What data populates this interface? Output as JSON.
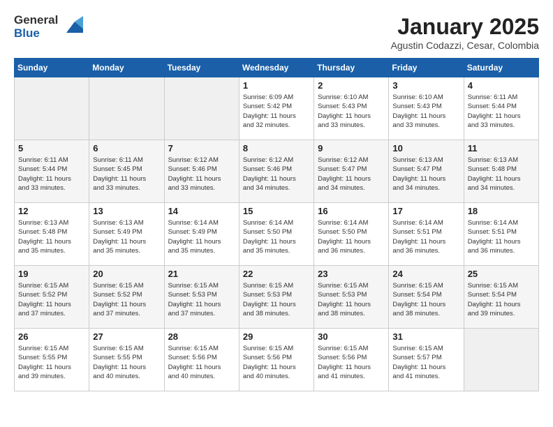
{
  "header": {
    "logo_general": "General",
    "logo_blue": "Blue",
    "month_title": "January 2025",
    "subtitle": "Agustin Codazzi, Cesar, Colombia"
  },
  "weekdays": [
    "Sunday",
    "Monday",
    "Tuesday",
    "Wednesday",
    "Thursday",
    "Friday",
    "Saturday"
  ],
  "weeks": [
    [
      {
        "day": "",
        "info": ""
      },
      {
        "day": "",
        "info": ""
      },
      {
        "day": "",
        "info": ""
      },
      {
        "day": "1",
        "info": "Sunrise: 6:09 AM\nSunset: 5:42 PM\nDaylight: 11 hours\nand 32 minutes."
      },
      {
        "day": "2",
        "info": "Sunrise: 6:10 AM\nSunset: 5:43 PM\nDaylight: 11 hours\nand 33 minutes."
      },
      {
        "day": "3",
        "info": "Sunrise: 6:10 AM\nSunset: 5:43 PM\nDaylight: 11 hours\nand 33 minutes."
      },
      {
        "day": "4",
        "info": "Sunrise: 6:11 AM\nSunset: 5:44 PM\nDaylight: 11 hours\nand 33 minutes."
      }
    ],
    [
      {
        "day": "5",
        "info": "Sunrise: 6:11 AM\nSunset: 5:44 PM\nDaylight: 11 hours\nand 33 minutes."
      },
      {
        "day": "6",
        "info": "Sunrise: 6:11 AM\nSunset: 5:45 PM\nDaylight: 11 hours\nand 33 minutes."
      },
      {
        "day": "7",
        "info": "Sunrise: 6:12 AM\nSunset: 5:46 PM\nDaylight: 11 hours\nand 33 minutes."
      },
      {
        "day": "8",
        "info": "Sunrise: 6:12 AM\nSunset: 5:46 PM\nDaylight: 11 hours\nand 34 minutes."
      },
      {
        "day": "9",
        "info": "Sunrise: 6:12 AM\nSunset: 5:47 PM\nDaylight: 11 hours\nand 34 minutes."
      },
      {
        "day": "10",
        "info": "Sunrise: 6:13 AM\nSunset: 5:47 PM\nDaylight: 11 hours\nand 34 minutes."
      },
      {
        "day": "11",
        "info": "Sunrise: 6:13 AM\nSunset: 5:48 PM\nDaylight: 11 hours\nand 34 minutes."
      }
    ],
    [
      {
        "day": "12",
        "info": "Sunrise: 6:13 AM\nSunset: 5:48 PM\nDaylight: 11 hours\nand 35 minutes."
      },
      {
        "day": "13",
        "info": "Sunrise: 6:13 AM\nSunset: 5:49 PM\nDaylight: 11 hours\nand 35 minutes."
      },
      {
        "day": "14",
        "info": "Sunrise: 6:14 AM\nSunset: 5:49 PM\nDaylight: 11 hours\nand 35 minutes."
      },
      {
        "day": "15",
        "info": "Sunrise: 6:14 AM\nSunset: 5:50 PM\nDaylight: 11 hours\nand 35 minutes."
      },
      {
        "day": "16",
        "info": "Sunrise: 6:14 AM\nSunset: 5:50 PM\nDaylight: 11 hours\nand 36 minutes."
      },
      {
        "day": "17",
        "info": "Sunrise: 6:14 AM\nSunset: 5:51 PM\nDaylight: 11 hours\nand 36 minutes."
      },
      {
        "day": "18",
        "info": "Sunrise: 6:14 AM\nSunset: 5:51 PM\nDaylight: 11 hours\nand 36 minutes."
      }
    ],
    [
      {
        "day": "19",
        "info": "Sunrise: 6:15 AM\nSunset: 5:52 PM\nDaylight: 11 hours\nand 37 minutes."
      },
      {
        "day": "20",
        "info": "Sunrise: 6:15 AM\nSunset: 5:52 PM\nDaylight: 11 hours\nand 37 minutes."
      },
      {
        "day": "21",
        "info": "Sunrise: 6:15 AM\nSunset: 5:53 PM\nDaylight: 11 hours\nand 37 minutes."
      },
      {
        "day": "22",
        "info": "Sunrise: 6:15 AM\nSunset: 5:53 PM\nDaylight: 11 hours\nand 38 minutes."
      },
      {
        "day": "23",
        "info": "Sunrise: 6:15 AM\nSunset: 5:53 PM\nDaylight: 11 hours\nand 38 minutes."
      },
      {
        "day": "24",
        "info": "Sunrise: 6:15 AM\nSunset: 5:54 PM\nDaylight: 11 hours\nand 38 minutes."
      },
      {
        "day": "25",
        "info": "Sunrise: 6:15 AM\nSunset: 5:54 PM\nDaylight: 11 hours\nand 39 minutes."
      }
    ],
    [
      {
        "day": "26",
        "info": "Sunrise: 6:15 AM\nSunset: 5:55 PM\nDaylight: 11 hours\nand 39 minutes."
      },
      {
        "day": "27",
        "info": "Sunrise: 6:15 AM\nSunset: 5:55 PM\nDaylight: 11 hours\nand 40 minutes."
      },
      {
        "day": "28",
        "info": "Sunrise: 6:15 AM\nSunset: 5:56 PM\nDaylight: 11 hours\nand 40 minutes."
      },
      {
        "day": "29",
        "info": "Sunrise: 6:15 AM\nSunset: 5:56 PM\nDaylight: 11 hours\nand 40 minutes."
      },
      {
        "day": "30",
        "info": "Sunrise: 6:15 AM\nSunset: 5:56 PM\nDaylight: 11 hours\nand 41 minutes."
      },
      {
        "day": "31",
        "info": "Sunrise: 6:15 AM\nSunset: 5:57 PM\nDaylight: 11 hours\nand 41 minutes."
      },
      {
        "day": "",
        "info": ""
      }
    ]
  ]
}
